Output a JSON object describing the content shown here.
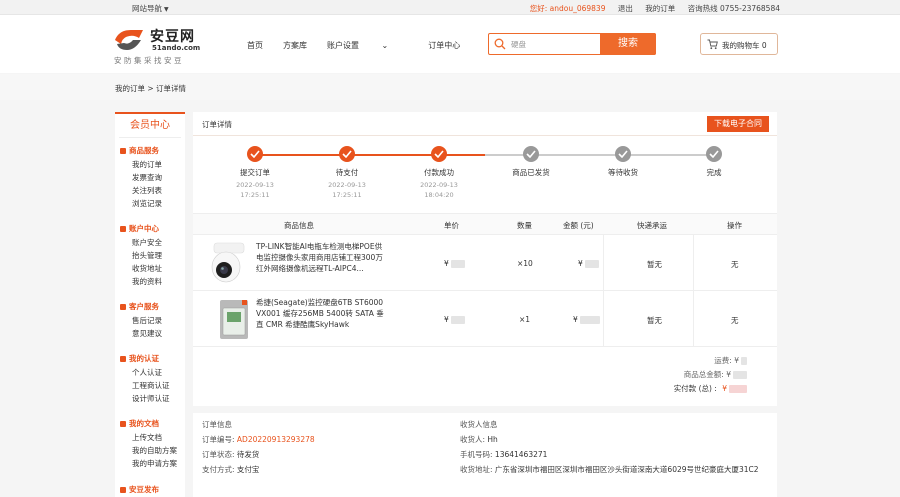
{
  "topbar": {
    "site_nav": "网站导航",
    "user_greeting": "您好: andou_069839",
    "logout": "退出",
    "my_orders": "我的订单",
    "hotline": "咨询热线 0755-23768584"
  },
  "header": {
    "logo_name": "安豆网",
    "logo_domain": "51ando.com",
    "slogan": "安防集采找安豆",
    "nav": [
      "首页",
      "方案库",
      "账户设置",
      "订单中心"
    ],
    "search_placeholder": "硬盘",
    "search_button": "搜索",
    "cart_label": "我的购物车",
    "cart_count": "0"
  },
  "breadcrumb": "我的订单 > 订单详情",
  "sidebar": {
    "title": "会员中心",
    "sections": [
      {
        "name": "商品服务",
        "items": [
          "我的订单",
          "发票查询",
          "关注列表",
          "浏览记录"
        ]
      },
      {
        "name": "账户中心",
        "items": [
          "账户安全",
          "抬头管理",
          "收货地址",
          "我的资料"
        ]
      },
      {
        "name": "客户服务",
        "items": [
          "售后记录",
          "意见建议"
        ]
      },
      {
        "name": "我的认证",
        "items": [
          "个人认证",
          "工程商认证",
          "设计师认证"
        ]
      },
      {
        "name": "我的文档",
        "items": [
          "上传文档",
          "我的自助方案",
          "我的申请方案"
        ]
      },
      {
        "name": "安豆发布",
        "items": []
      }
    ]
  },
  "panel": {
    "title": "订单详情",
    "download_contract": "下载电子合同"
  },
  "steps": [
    {
      "label": "提交订单",
      "date": "2022-09-13",
      "time": "17:25:11",
      "done": true
    },
    {
      "label": "待支付",
      "date": "2022-09-13",
      "time": "17:25:11",
      "done": true
    },
    {
      "label": "付款成功",
      "date": "2022-09-13",
      "time": "18:04:20",
      "done": true
    },
    {
      "label": "商品已发货",
      "date": "",
      "time": "",
      "done": false
    },
    {
      "label": "等待收货",
      "date": "",
      "time": "",
      "done": false
    },
    {
      "label": "完成",
      "date": "",
      "time": "",
      "done": false
    }
  ],
  "table": {
    "headers": [
      "商品信息",
      "单价",
      "数量",
      "金额 (元)",
      "快递承运",
      "操作"
    ],
    "rows": [
      {
        "name": "TP-LINK智能AI电瓶车检测电梯POE供电监控摄像头家用商用店铺工程300万红外网络摄像机远程TL-AIPC4...",
        "unit_price": "¥",
        "qty": "×10",
        "amount": "¥",
        "carrier": "暂无",
        "action": "无"
      },
      {
        "name": "希捷(Seagate)监控硬盘6TB ST6000VX001 缓存256MB 5400转 SATA 垂直 CMR 希捷酷鹰SkyHawk",
        "unit_price": "¥",
        "qty": "×1",
        "amount": "¥",
        "carrier": "暂无",
        "action": "无"
      }
    ]
  },
  "totals": {
    "shipping_label": "运费: ",
    "goods_total_label": "商品总金额: ",
    "paid_label": "实付款 (总) : ",
    "currency": "¥"
  },
  "order_info": {
    "title": "订单信息",
    "number_label": "订单编号: ",
    "number": "AD20220913293278",
    "status_label": "订单状态: ",
    "status": "待发货",
    "payment_label": "支付方式: ",
    "payment": "支付宝"
  },
  "receiver": {
    "title": "收货人信息",
    "name_label": "收货人: ",
    "name": "Hh",
    "phone_label": "手机号码: ",
    "phone": "13641463271",
    "address_label": "收货地址: ",
    "address": "广东省深圳市福田区深圳市福田区沙头街道深南大道6029号世纪豪庭大厦31C2"
  },
  "colors": {
    "accent": "#e8531d",
    "pending": "#999999"
  }
}
